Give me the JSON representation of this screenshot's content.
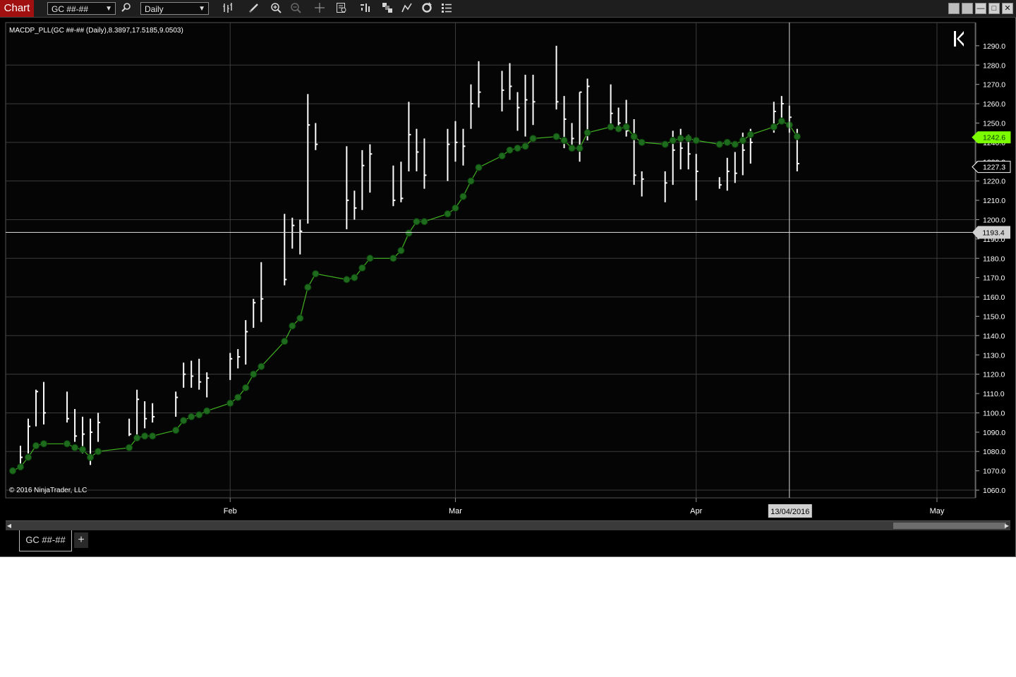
{
  "toolbar": {
    "window_label": "Chart",
    "instrument": "GC ##-##",
    "period": "Daily"
  },
  "tab": {
    "label": "GC ##-##",
    "add": "+"
  },
  "colors": {
    "background": "#000000",
    "bars": "#ffffff",
    "indicator_line": "#3fb21f",
    "indicator_dot": "#1e6b1e",
    "last_price_marker": "#7cfc00",
    "grid": "#3c3c3c"
  },
  "chart_data": {
    "type": "ohlc",
    "indicator_label": "MACDP_PLL(GC ##-## (Daily),8.3897,17.5185,9.0503)",
    "copyright": "© 2016 NinjaTrader, LLC",
    "x_labels": [
      "Feb",
      "Mar",
      "Apr",
      "May"
    ],
    "x_label_dates": [
      "2016-02-01",
      "2016-03-01",
      "2016-04-01",
      "2016-05-02"
    ],
    "y_ticks": [
      1060,
      1070,
      1080,
      1090,
      1100,
      1110,
      1120,
      1130,
      1140,
      1150,
      1160,
      1170,
      1180,
      1190,
      1200,
      1210,
      1220,
      1230,
      1240,
      1250,
      1260,
      1270,
      1280,
      1290
    ],
    "ylim": [
      1056,
      1302
    ],
    "date_range": [
      "2016-01-04",
      "2016-05-06"
    ],
    "crosshair": {
      "date_label": "13/04/2016",
      "date": "2016-04-13",
      "price_label": "1193.4",
      "price": 1193.4
    },
    "price_markers": [
      {
        "value": "1242.6",
        "price": 1242.6,
        "style": "last"
      },
      {
        "value": "1227.3",
        "price": 1227.3,
        "style": "outline"
      }
    ],
    "bars": [
      [
        "2016-01-05",
        1083,
        1073,
        1077
      ],
      [
        "2016-01-06",
        1097,
        1079,
        1093
      ],
      [
        "2016-01-07",
        1112,
        1093,
        1111
      ],
      [
        "2016-01-08",
        1116,
        1094,
        1100
      ],
      [
        "2016-01-11",
        1111,
        1095,
        1097
      ],
      [
        "2016-01-12",
        1102,
        1085,
        1088
      ],
      [
        "2016-01-13",
        1098,
        1079,
        1089
      ],
      [
        "2016-01-14",
        1097,
        1073,
        1090
      ],
      [
        "2016-01-15",
        1100,
        1085,
        1095
      ],
      [
        "2016-01-19",
        1097,
        1088,
        1089
      ],
      [
        "2016-01-20",
        1112,
        1087,
        1107
      ],
      [
        "2016-01-21",
        1106,
        1092,
        1097
      ],
      [
        "2016-01-22",
        1105,
        1095,
        1098
      ],
      [
        "2016-01-25",
        1111,
        1098,
        1108
      ],
      [
        "2016-01-26",
        1126,
        1113,
        1120
      ],
      [
        "2016-01-27",
        1127,
        1113,
        1119
      ],
      [
        "2016-01-28",
        1128,
        1112,
        1116
      ],
      [
        "2016-01-29",
        1121,
        1108,
        1118
      ],
      [
        "2016-02-01",
        1131,
        1117,
        1128
      ],
      [
        "2016-02-02",
        1133,
        1123,
        1129
      ],
      [
        "2016-02-03",
        1148,
        1125,
        1142
      ],
      [
        "2016-02-04",
        1159,
        1144,
        1157
      ],
      [
        "2016-02-05",
        1178,
        1147,
        1159
      ],
      [
        "2016-02-08",
        1203,
        1166,
        1169
      ],
      [
        "2016-02-09",
        1201,
        1185,
        1197
      ],
      [
        "2016-02-10",
        1200,
        1182,
        1194
      ],
      [
        "2016-02-11",
        1265,
        1198,
        1249
      ],
      [
        "2016-02-12",
        1250,
        1236,
        1239
      ],
      [
        "2016-02-16",
        1238,
        1195,
        1210
      ],
      [
        "2016-02-17",
        1215,
        1200,
        1206
      ],
      [
        "2016-02-18",
        1236,
        1205,
        1228
      ],
      [
        "2016-02-19",
        1239,
        1214,
        1234
      ],
      [
        "2016-02-22",
        1228,
        1207,
        1210
      ],
      [
        "2016-02-23",
        1230,
        1209,
        1211
      ],
      [
        "2016-02-24",
        1261,
        1225,
        1244
      ],
      [
        "2016-02-25",
        1247,
        1225,
        1235
      ],
      [
        "2016-02-26",
        1242,
        1216,
        1223
      ],
      [
        "2016-02-29",
        1247,
        1220,
        1239
      ],
      [
        "2016-03-01",
        1251,
        1230,
        1240
      ],
      [
        "2016-03-02",
        1247,
        1228,
        1238
      ],
      [
        "2016-03-03",
        1270,
        1247,
        1260
      ],
      [
        "2016-03-04",
        1282,
        1258,
        1266
      ],
      [
        "2016-03-07",
        1277,
        1256,
        1267
      ],
      [
        "2016-03-08",
        1281,
        1262,
        1269
      ],
      [
        "2016-03-09",
        1266,
        1246,
        1258
      ],
      [
        "2016-03-10",
        1275,
        1243,
        1262
      ],
      [
        "2016-03-11",
        1275,
        1249,
        1261
      ],
      [
        "2016-03-14",
        1290,
        1257,
        1261
      ],
      [
        "2016-03-15",
        1264,
        1237,
        1252
      ],
      [
        "2016-03-16",
        1250,
        1238,
        1242
      ],
      [
        "2016-03-17",
        1266,
        1230,
        1266
      ],
      [
        "2016-03-18",
        1273,
        1241,
        1269
      ],
      [
        "2016-03-21",
        1270,
        1247,
        1255
      ],
      [
        "2016-03-22",
        1258,
        1246,
        1250
      ],
      [
        "2016-03-23",
        1262,
        1243,
        1246
      ],
      [
        "2016-03-24",
        1252,
        1218,
        1223
      ],
      [
        "2016-03-25",
        1225,
        1212,
        1221
      ],
      [
        "2016-03-28",
        1225,
        1209,
        1219
      ],
      [
        "2016-03-29",
        1246,
        1218,
        1236
      ],
      [
        "2016-03-30",
        1247,
        1226,
        1237
      ],
      [
        "2016-03-31",
        1244,
        1226,
        1234
      ],
      [
        "2016-04-01",
        1234,
        1210,
        1225
      ],
      [
        "2016-04-04",
        1222,
        1216,
        1218
      ],
      [
        "2016-04-05",
        1232,
        1215,
        1225
      ],
      [
        "2016-04-06",
        1235,
        1219,
        1224
      ],
      [
        "2016-04-07",
        1245,
        1223,
        1236
      ],
      [
        "2016-04-08",
        1247,
        1229,
        1240
      ],
      [
        "2016-04-11",
        1261,
        1245,
        1256
      ],
      [
        "2016-04-12",
        1264,
        1250,
        1260
      ],
      [
        "2016-04-13",
        1259,
        1245,
        1253
      ],
      [
        "2016-04-14",
        1247,
        1225,
        1229
      ]
    ],
    "series": [
      {
        "name": "MACDP_PLL",
        "values": [
          [
            "2016-01-04",
            1070
          ],
          [
            "2016-01-05",
            1072
          ],
          [
            "2016-01-06",
            1077
          ],
          [
            "2016-01-07",
            1083
          ],
          [
            "2016-01-08",
            1084
          ],
          [
            "2016-01-11",
            1084
          ],
          [
            "2016-01-12",
            1082
          ],
          [
            "2016-01-13",
            1081
          ],
          [
            "2016-01-14",
            1077
          ],
          [
            "2016-01-15",
            1080
          ],
          [
            "2016-01-19",
            1082
          ],
          [
            "2016-01-20",
            1087
          ],
          [
            "2016-01-21",
            1088
          ],
          [
            "2016-01-22",
            1088
          ],
          [
            "2016-01-25",
            1091
          ],
          [
            "2016-01-26",
            1096
          ],
          [
            "2016-01-27",
            1098
          ],
          [
            "2016-01-28",
            1099
          ],
          [
            "2016-01-29",
            1101
          ],
          [
            "2016-02-01",
            1105
          ],
          [
            "2016-02-02",
            1108
          ],
          [
            "2016-02-03",
            1113
          ],
          [
            "2016-02-04",
            1120
          ],
          [
            "2016-02-05",
            1124
          ],
          [
            "2016-02-08",
            1137
          ],
          [
            "2016-02-09",
            1145
          ],
          [
            "2016-02-10",
            1149
          ],
          [
            "2016-02-11",
            1165
          ],
          [
            "2016-02-12",
            1172
          ],
          [
            "2016-02-16",
            1169
          ],
          [
            "2016-02-17",
            1170
          ],
          [
            "2016-02-18",
            1175
          ],
          [
            "2016-02-19",
            1180
          ],
          [
            "2016-02-22",
            1180
          ],
          [
            "2016-02-23",
            1184
          ],
          [
            "2016-02-24",
            1193
          ],
          [
            "2016-02-25",
            1199
          ],
          [
            "2016-02-26",
            1199
          ],
          [
            "2016-02-29",
            1203
          ],
          [
            "2016-03-01",
            1206
          ],
          [
            "2016-03-02",
            1212
          ],
          [
            "2016-03-03",
            1220
          ],
          [
            "2016-03-04",
            1227
          ],
          [
            "2016-03-07",
            1233
          ],
          [
            "2016-03-08",
            1236
          ],
          [
            "2016-03-09",
            1237
          ],
          [
            "2016-03-10",
            1238
          ],
          [
            "2016-03-11",
            1242
          ],
          [
            "2016-03-14",
            1243
          ],
          [
            "2016-03-15",
            1241
          ],
          [
            "2016-03-16",
            1237
          ],
          [
            "2016-03-17",
            1237
          ],
          [
            "2016-03-18",
            1245
          ],
          [
            "2016-03-21",
            1248
          ],
          [
            "2016-03-22",
            1247
          ],
          [
            "2016-03-23",
            1248
          ],
          [
            "2016-03-24",
            1243
          ],
          [
            "2016-03-25",
            1240
          ],
          [
            "2016-03-28",
            1239
          ],
          [
            "2016-03-29",
            1241
          ],
          [
            "2016-03-30",
            1242
          ],
          [
            "2016-03-31",
            1242
          ],
          [
            "2016-04-01",
            1241
          ],
          [
            "2016-04-04",
            1239
          ],
          [
            "2016-04-05",
            1240
          ],
          [
            "2016-04-06",
            1239
          ],
          [
            "2016-04-07",
            1241
          ],
          [
            "2016-04-08",
            1244
          ],
          [
            "2016-04-11",
            1248
          ],
          [
            "2016-04-12",
            1251
          ],
          [
            "2016-04-13",
            1249
          ],
          [
            "2016-04-14",
            1243
          ]
        ]
      }
    ]
  }
}
